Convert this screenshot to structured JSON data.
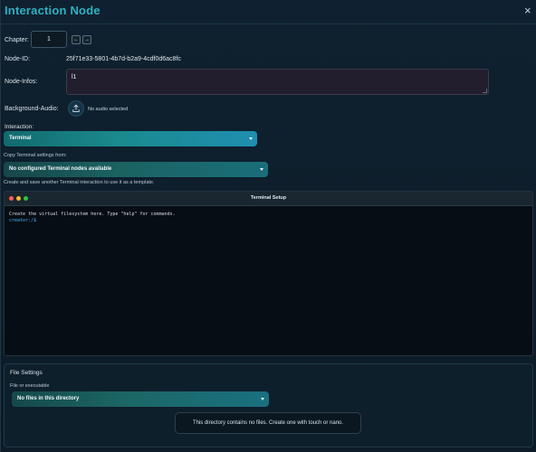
{
  "header": {
    "title": "Interaction Node",
    "close_label": "×"
  },
  "chapter": {
    "label": "Chapter:",
    "value": "1",
    "prev": "←",
    "next": "→"
  },
  "node_id": {
    "label": "Node-ID:",
    "value": "25f71e33-5801-4b7d-b2a9-4cdf0d6ac8fc"
  },
  "node_infos": {
    "label": "Node-Infos:",
    "value": "l1"
  },
  "background_audio": {
    "label": "Background-Audio:",
    "status": "No audio selected",
    "icon": "upload-icon"
  },
  "interaction": {
    "label": "Interaction:",
    "selected": "Terminal"
  },
  "copy_settings": {
    "label": "Copy Terminal settings from:",
    "selected": "No configured Terminal nodes available",
    "hint": "Create and save another Terminal interaction to use it as a template."
  },
  "terminal": {
    "title": "Terminal Setup",
    "lines": [
      "Create the virtual filesystem here. Type \"help\" for commands.",
      "creator:/$"
    ],
    "dot_colors": [
      "#ff5f57",
      "#febc2e",
      "#28c840"
    ]
  },
  "file_settings": {
    "title": "File Settings",
    "field_label": "File or executable",
    "selected": "No files in this directory",
    "empty_message": "This directory contains no files. Create one with touch or nano."
  },
  "colors": {
    "accent": "#2eb0c4",
    "prompt": "#4fb3ff"
  }
}
